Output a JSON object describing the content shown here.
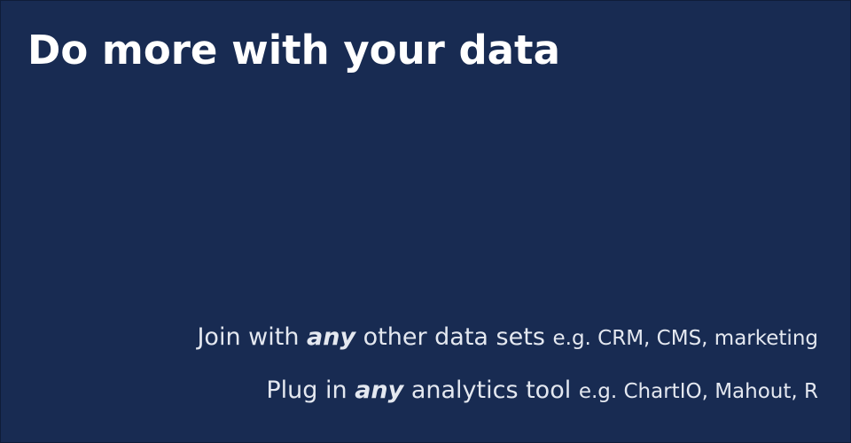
{
  "slide": {
    "title": "Do more with your data",
    "colors": {
      "background": "#182b52",
      "title": "#ffffff",
      "body": "#e4e8f0"
    },
    "lines": [
      {
        "before": "Join with ",
        "emphasis": "any",
        "after": " other data sets ",
        "example": "e.g. CRM, CMS, marketing"
      },
      {
        "before": "Plug in ",
        "emphasis": "any",
        "after": " analytics tool ",
        "example": "e.g. ChartIO, Mahout, R"
      }
    ]
  }
}
